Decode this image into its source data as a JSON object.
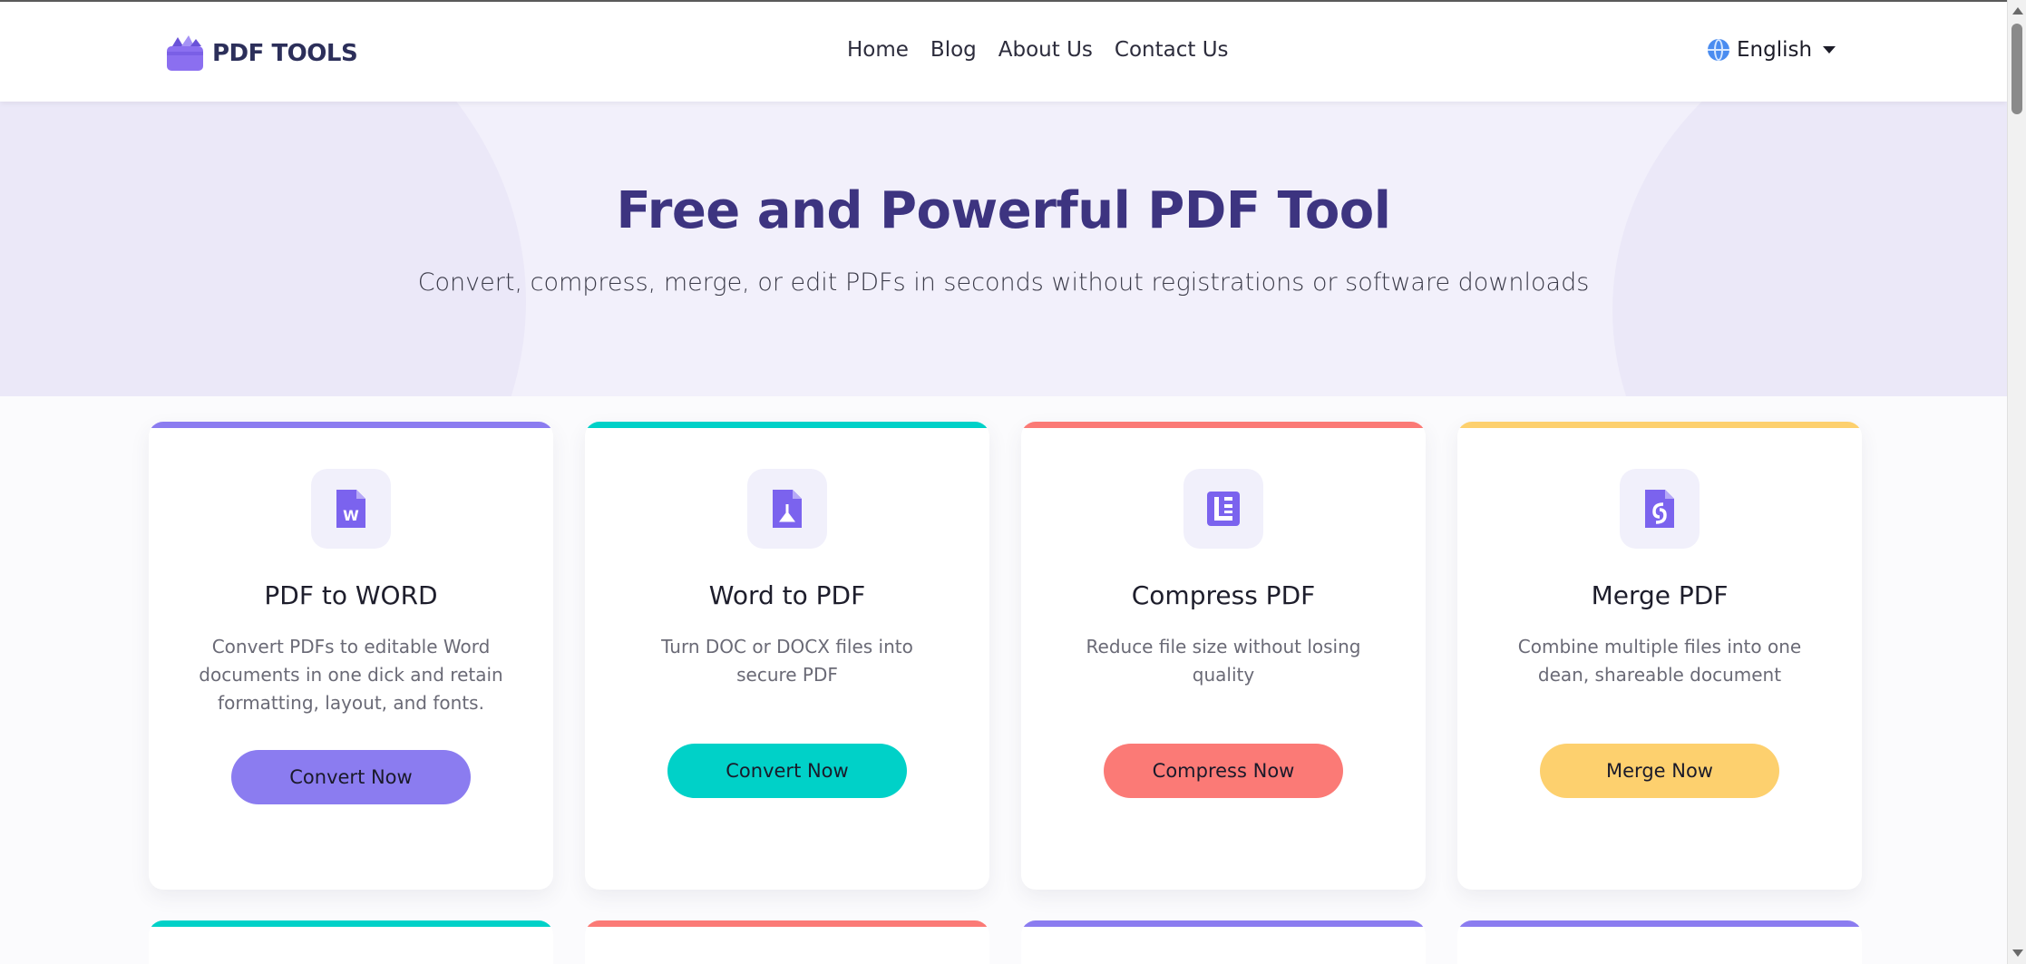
{
  "header": {
    "logo_text": "PDF TOOLS",
    "nav": [
      "Home",
      "Blog",
      "About Us",
      "Contact Us"
    ],
    "language": "English"
  },
  "hero": {
    "title": "Free and Powerful PDF Tool",
    "subtitle": "Convert, compress, merge, or edit PDFs in seconds without registrations or software downloads"
  },
  "cards": [
    {
      "title": "PDF to WORD",
      "description": "Convert PDFs to editable Word documents in one dick and retain formatting, layout, and fonts.",
      "button": "Convert Now",
      "icon": "word-file-icon",
      "accent": "#8b7cf0"
    },
    {
      "title": "Word to PDF",
      "description": "Turn DOC or DOCX files into secure PDF",
      "button": "Convert Now",
      "icon": "pdf-file-icon",
      "accent": "#00d1c8"
    },
    {
      "title": "Compress PDF",
      "description": "Reduce file size without losing quality",
      "button": "Compress Now",
      "icon": "compress-icon",
      "accent": "#fb7a76"
    },
    {
      "title": "Merge PDF",
      "description": "Combine multiple files into one dean, shareable document",
      "button": "Merge Now",
      "icon": "merge-icon",
      "accent": "#fdd06e"
    }
  ],
  "next_row_accents": [
    "#00d1c8",
    "#fb7a76",
    "#8b7cf0",
    "#8b7cf0"
  ],
  "colors": {
    "brand": "#3d3480",
    "hero_background": "#f2f0fb"
  }
}
